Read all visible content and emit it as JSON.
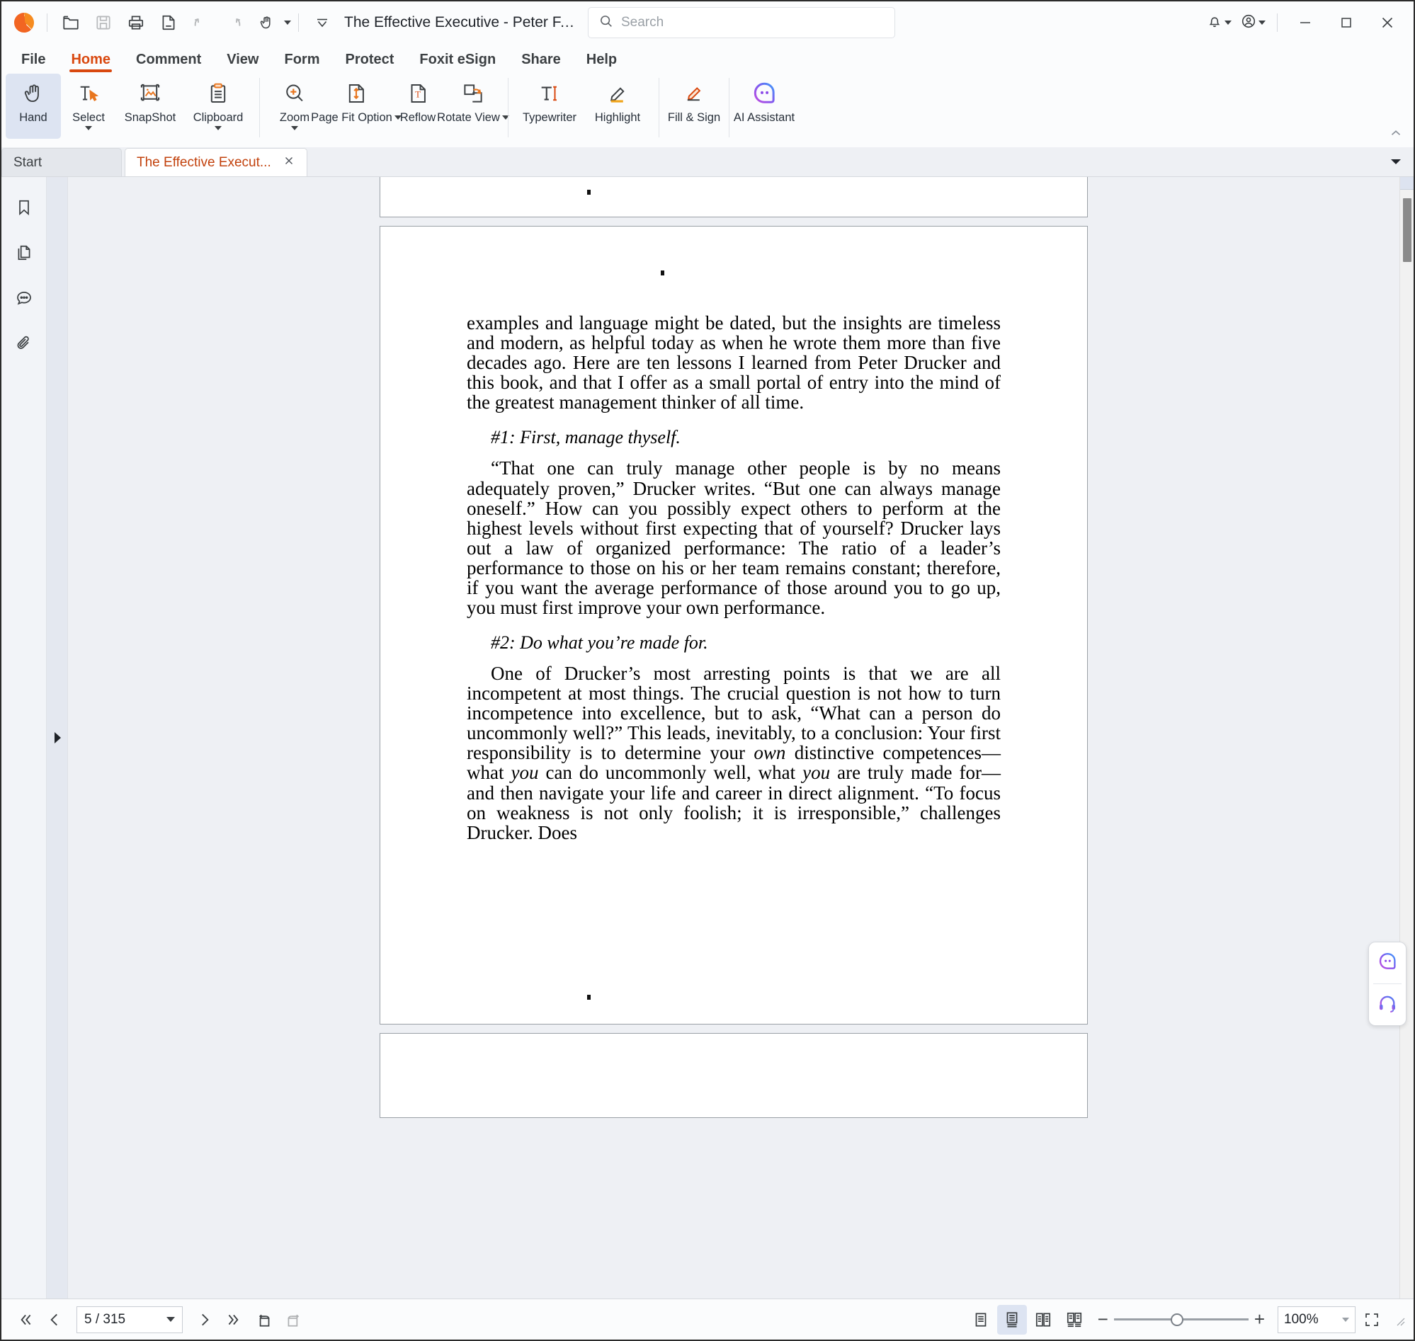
{
  "window": {
    "title": "The Effective Executive - Peter F. D...",
    "logo_icon": "foxit-logo-icon"
  },
  "quick_access": [
    {
      "name": "open-file-button",
      "icon": "folder-open-icon",
      "disabled": false
    },
    {
      "name": "save-button",
      "icon": "save-floppy-icon",
      "disabled": true
    },
    {
      "name": "print-button",
      "icon": "printer-icon",
      "disabled": false
    },
    {
      "name": "export-pdf-button",
      "icon": "file-export-icon",
      "disabled": false
    },
    {
      "name": "undo-button",
      "icon": "undo-arrow-icon",
      "disabled": true
    },
    {
      "name": "redo-button",
      "icon": "redo-arrow-icon",
      "disabled": true
    },
    {
      "name": "hand-tool-button",
      "icon": "hand-pointer-icon",
      "disabled": false
    }
  ],
  "search": {
    "placeholder": "Search",
    "value": "",
    "icon": "search-icon"
  },
  "titlebar_right": {
    "notifications_icon": "bell-icon",
    "account_icon": "user-circle-icon",
    "minimize_icon": "minimize-icon",
    "maximize_icon": "maximize-square-icon",
    "close_icon": "close-x-icon"
  },
  "menu": {
    "items": [
      {
        "label": "File",
        "active": false
      },
      {
        "label": "Home",
        "active": true
      },
      {
        "label": "Comment",
        "active": false
      },
      {
        "label": "View",
        "active": false
      },
      {
        "label": "Form",
        "active": false
      },
      {
        "label": "Protect",
        "active": false
      },
      {
        "label": "Foxit eSign",
        "active": false
      },
      {
        "label": "Share",
        "active": false
      },
      {
        "label": "Help",
        "active": false
      }
    ]
  },
  "ribbon": {
    "groups": [
      {
        "items": [
          {
            "label": "Hand",
            "icon": "hand-icon",
            "caret": false,
            "active": true
          },
          {
            "label": "Select",
            "icon": "select-text-icon",
            "caret": true,
            "active": false
          },
          {
            "label": "SnapShot",
            "icon": "snapshot-image-icon",
            "caret": false,
            "active": false
          },
          {
            "label": "Clipboard",
            "icon": "clipboard-icon",
            "caret": true,
            "active": false
          }
        ]
      },
      {
        "items": [
          {
            "label": "Zoom",
            "icon": "zoom-magnifier-plus-icon",
            "caret": true,
            "active": false
          },
          {
            "label": "Page Fit Option",
            "icon": "page-fit-icon",
            "caret": true,
            "active": false
          },
          {
            "label": "Reflow",
            "icon": "reflow-text-icon",
            "caret": false,
            "active": false
          },
          {
            "label": "Rotate View",
            "icon": "rotate-view-icon",
            "caret": true,
            "active": false
          }
        ]
      },
      {
        "items": [
          {
            "label": "Typewriter",
            "icon": "typewriter-icon",
            "caret": false,
            "active": false
          },
          {
            "label": "Highlight",
            "icon": "highlighter-icon",
            "caret": false,
            "active": false
          }
        ]
      },
      {
        "items": [
          {
            "label": "Fill & Sign",
            "icon": "fill-sign-pen-icon",
            "caret": false,
            "active": false
          }
        ]
      },
      {
        "items": [
          {
            "label": "AI Assistant",
            "icon": "ai-assistant-icon",
            "caret": false,
            "active": false
          }
        ]
      }
    ],
    "collapse_icon": "chevron-up-icon"
  },
  "tabs": {
    "items": [
      {
        "label": "Start",
        "active": false,
        "closable": false
      },
      {
        "label": "The Effective Execut...",
        "active": true,
        "closable": true,
        "close_icon": "close-x-icon"
      }
    ],
    "dropdown_icon": "chevron-down-icon"
  },
  "left_rail": {
    "items": [
      {
        "name": "bookmarks-panel-button",
        "icon": "bookmark-icon"
      },
      {
        "name": "page-thumbnails-panel-button",
        "icon": "pages-icon"
      },
      {
        "name": "comments-panel-button",
        "icon": "comment-bubble-icon"
      },
      {
        "name": "attachments-panel-button",
        "icon": "paperclip-icon"
      }
    ],
    "expand_icon": "triangle-right-icon"
  },
  "document": {
    "paragraph1": "examples and language might be dated, but the insights are timeless and modern, as helpful today as when he wrote them more than five decades ago. Here are ten lessons I learned from Peter Drucker and this book, and that I offer as a small portal of entry into the mind of the greatest management thinker of all time.",
    "heading1": "#1: First, manage thyself.",
    "paragraph2": "“That one can truly manage other people is by no means adequately proven,” Drucker writes. “But one can always manage oneself.” How can you possibly expect others to perform at the highest levels without first expecting that of yourself? Drucker lays out a law of organized performance: The ratio of a leader’s performance to those on his or her team remains constant; therefore, if you want the average performance of those around you to go up, you must first improve your own performance.",
    "heading2": "#2: Do what you’re made for.",
    "paragraph3_a": "One of Drucker’s most arresting points is that we are all incompetent at most things. The crucial question is not how to turn incompetence into excellence, but to ask, “What can a person do uncommonly well?” This leads, inevitably, to a conclusion: Your first responsibility is to determine your ",
    "paragraph3_em1": "own",
    "paragraph3_b": " distinctive competences—what ",
    "paragraph3_em2": "you",
    "paragraph3_c": " can do uncommonly well, what ",
    "paragraph3_em3": "you",
    "paragraph3_d": " are truly made for—and then navigate your life and career in direct alignment. “To focus on weakness is not only foolish; it is irresponsible,” challenges Drucker. Does"
  },
  "dock": {
    "items": [
      {
        "name": "ai-chat-button",
        "icon": "ai-assistant-icon"
      },
      {
        "name": "support-headset-button",
        "icon": "headset-icon"
      }
    ]
  },
  "statusbar": {
    "first_page_icon": "double-chevron-left-icon",
    "prev_page_icon": "chevron-left-icon",
    "page_value": "5 / 315",
    "next_page_icon": "chevron-right-icon",
    "last_page_icon": "double-chevron-right-icon",
    "rotate_left_icon": "rotate-left-page-icon",
    "rotate_right_icon": "rotate-right-page-icon",
    "view_modes": [
      {
        "name": "single-page-view-button",
        "icon": "single-page-icon",
        "active": false
      },
      {
        "name": "continuous-scroll-view-button",
        "icon": "continuous-page-icon",
        "active": true
      },
      {
        "name": "two-page-view-button",
        "icon": "two-page-icon",
        "active": false
      },
      {
        "name": "two-page-continuous-view-button",
        "icon": "two-page-continuous-icon",
        "active": false
      }
    ],
    "zoom_out_label": "−",
    "zoom_in_label": "+",
    "zoom_value": "100%",
    "zoom_dropdown_icon": "chevron-down-icon",
    "fullscreen_icon": "expand-arrows-icon"
  }
}
